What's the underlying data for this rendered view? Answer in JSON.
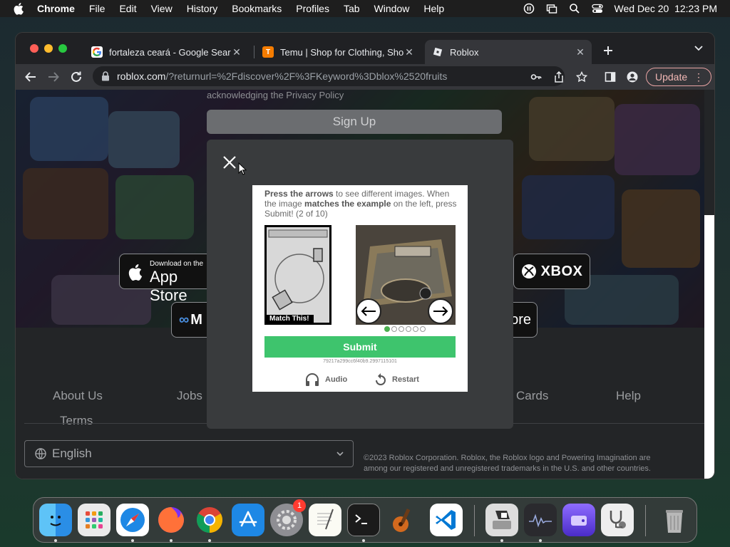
{
  "menubar": {
    "app_name": "Chrome",
    "items": [
      "File",
      "Edit",
      "View",
      "History",
      "Bookmarks",
      "Profiles",
      "Tab",
      "Window",
      "Help"
    ],
    "clock": "Wed Dec 20  12:23 PM"
  },
  "browser": {
    "tabs": [
      {
        "title": "fortaleza ceará - Google Search",
        "icon": "google-icon"
      },
      {
        "title": "Temu | Shop for Clothing, Shoes",
        "icon": "temu-icon"
      },
      {
        "title": "Roblox",
        "icon": "roblox-icon",
        "active": true
      }
    ],
    "url_host": "roblox.com",
    "url_path": "/?returnurl=%2Fdiscover%2F%3FKeyword%3Dblox%2520fruits",
    "update_label": "Update"
  },
  "page": {
    "signup_label": "Sign Up",
    "partial_text": "acknowledging the Privacy Policy",
    "stores": {
      "app_store_small": "Download on the",
      "app_store_big": "App Store",
      "xbox": "XBOX",
      "meta": "M",
      "microsoft": "ore"
    },
    "footer_links": [
      "About Us",
      "Jobs",
      "Cards",
      "Help",
      "Terms"
    ],
    "language": "English",
    "copyright_line1": "©2023 Roblox Corporation. Roblox, the Roblox logo and Powering Imagination are",
    "copyright_line2": "among our registered and unregistered trademarks in the U.S. and other countries."
  },
  "captcha": {
    "instr_bold1": "Press the arrows",
    "instr_text1": " to see different images. When the image ",
    "instr_bold2": "matches the example",
    "instr_text2": " on the left, press Submit! (2 of 10)",
    "match_label": "Match This!",
    "submit_label": "Submit",
    "session_id": "79217a299cc6f40b9.2997115101",
    "audio_label": "Audio",
    "restart_label": "Restart",
    "pager_total": 6,
    "pager_active": 1
  },
  "dock": {
    "settings_badge": "1"
  },
  "colors": {
    "submit_green": "#3ec46d",
    "update_pink": "#f2b8b5"
  }
}
